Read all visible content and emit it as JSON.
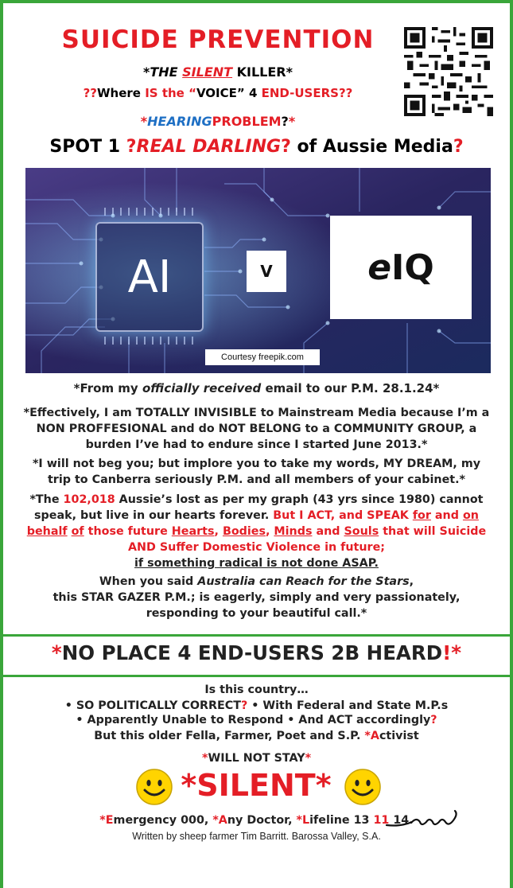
{
  "header": {
    "title": "SUICIDE PREVENTION",
    "sub1_a": "*THE ",
    "sub1_b": "SILENT",
    "sub1_c": " KILLER*",
    "sub2_a": "??",
    "sub2_b": "Where ",
    "sub2_c": "IS the ",
    "sub2_d": "“",
    "sub2_e": "VOICE",
    "sub2_f": "” 4 ",
    "sub2_g": "END-USERS",
    "sub2_h": "??",
    "sub3_a": "*",
    "sub3_b": "HEARING",
    "sub3_c": "PROBLEM",
    "sub3_d": "?",
    "sub3_e": "*",
    "spot_a": "SPOT 1 ",
    "spot_b": "?",
    "spot_c": "REAL ",
    "spot_d": "DARLING",
    "spot_e": "?",
    "spot_f": " of Aussie Media",
    "spot_g": "?"
  },
  "hero": {
    "ai_label": "AI",
    "v_label": "V",
    "eiq_e": "e",
    "eiq_rest": "IQ",
    "courtesy": "Courtesy freepik.com"
  },
  "body": {
    "p0_a": "*From my ",
    "p0_b": "officially received",
    "p0_c": " email to our P.M. 28.1.24*",
    "p1": "*Effectively, I am TOTALLY INVISIBLE to Mainstream Media because I’m a NON PROFFESIONAL and do NOT BELONG to a COMMUNITY GROUP, a burden I’ve had to endure since I started June 2013.*",
    "p2": "*I will not beg you; but implore you to take my words, MY DREAM, my trip to Canberra seriously P.M. and all members of your cabinet.*",
    "p3_a": "*The ",
    "p3_b": "102,018",
    "p3_c": " Aussie’s lost as per my graph (43 yrs since 1980) cannot speak, but live in our hearts forever. ",
    "p3_d": "But I ACT, and SPEAK ",
    "p3_e": "for",
    "p3_f": " and ",
    "p3_g": "on",
    "p3_h": " ",
    "p3_i": "behalf",
    "p3_j": " ",
    "p3_k": "of",
    "p3_l": " those future ",
    "p3_m": "Hearts",
    "p3_n": ", ",
    "p3_o": "Bodies",
    "p3_p": ", ",
    "p3_q": "Minds",
    "p3_r": " and ",
    "p3_s": "Souls",
    "p3_t": " that will Suicide AND Suffer Domestic Violence in future;",
    "p3_u": "if something radical is not done ASAP.",
    "p4_a": "When you said ",
    "p4_b": "Australia can Reach for the Stars",
    "p4_c": ",",
    "p4_d": "this STAR GAZER P.M.; is eagerly, simply and very passionately, responding to your beautiful call.*"
  },
  "band": {
    "a": "*",
    "b": "NO PLACE 4 END-USERS 2B HEARD",
    "c": "!*"
  },
  "tail": {
    "t1": "Is this country…",
    "t2_a": "• SO POLITICALLY CORRECT",
    "t2_b": "?",
    "t2_c": " • With Federal and State M.P.s",
    "t3_a": "• Apparently Unable to Respond • And ACT accordingly",
    "t3_b": "?",
    "t4_a": "But this older Fella, Farmer, Poet and S.P. ",
    "t4_b": "*A",
    "t4_c": "ctivist",
    "t5_a": "*",
    "t5_b": "WILL NOT STAY",
    "t5_c": "*",
    "silent": "*SILENT*",
    "em_a": "*E",
    "em_b": "mergency 000, ",
    "em_c": "*A",
    "em_d": "ny Doctor, ",
    "em_e": "*L",
    "em_f": "ifeline 13 ",
    "em_g": "11",
    "em_h": " 14.",
    "written": "Written by sheep farmer Tim Barritt. Barossa Valley, S.A."
  },
  "colors": {
    "accent_red": "#e41e26",
    "accent_blue": "#1e6fc4",
    "border_green": "#3aa63a"
  }
}
